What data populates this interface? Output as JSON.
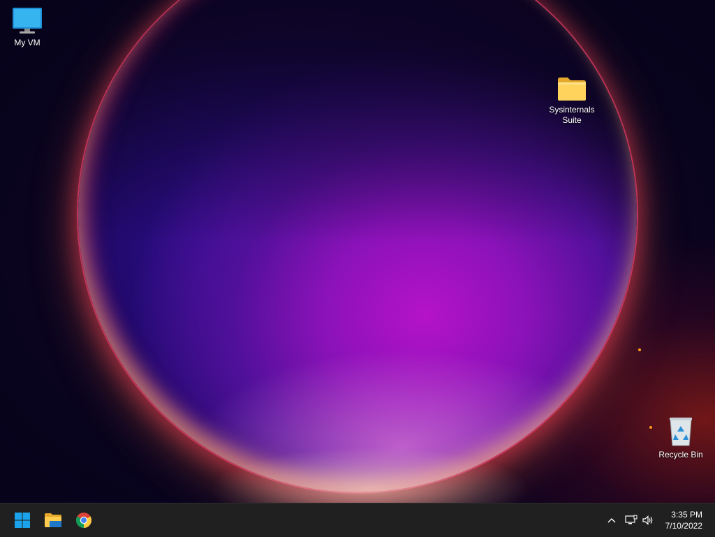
{
  "desktop": {
    "icons": [
      {
        "label": "My VM",
        "icon": "monitor-icon"
      },
      {
        "label": "Sysinternals Suite",
        "icon": "folder-icon"
      },
      {
        "label": "Recycle Bin",
        "icon": "recycle-bin-icon"
      }
    ],
    "accent": "#b513c8"
  },
  "taskbar": {
    "pinned": [
      {
        "name": "Start",
        "icon": "windows-start-icon"
      },
      {
        "name": "File Explorer",
        "icon": "file-explorer-icon"
      },
      {
        "name": "Google Chrome",
        "icon": "chrome-icon"
      }
    ],
    "tray": {
      "overflow_icon": "chevron-up-icon",
      "network_icon": "network-icon",
      "volume_icon": "speaker-icon"
    },
    "clock": {
      "time": "3:35 PM",
      "date": "7/10/2022"
    }
  }
}
